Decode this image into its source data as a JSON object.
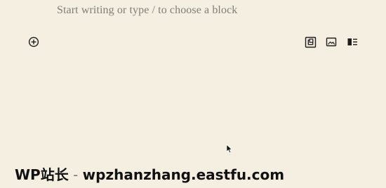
{
  "editor": {
    "placeholder": "Start writing or type / to choose a block"
  },
  "toolbar": {
    "add_block_icon": "plus-circle-icon",
    "gallery_icon": "gallery-icon",
    "image_icon": "image-icon",
    "media_text_icon": "media-text-icon"
  },
  "watermark": {
    "brand": "WP站长",
    "separator": " - ",
    "url": "wpzhanzhang.eastfu.com"
  },
  "colors": {
    "background": "#f4efe1",
    "placeholder": "#7f7d78",
    "icon": "#1e1e1e",
    "watermark": "#111111"
  }
}
